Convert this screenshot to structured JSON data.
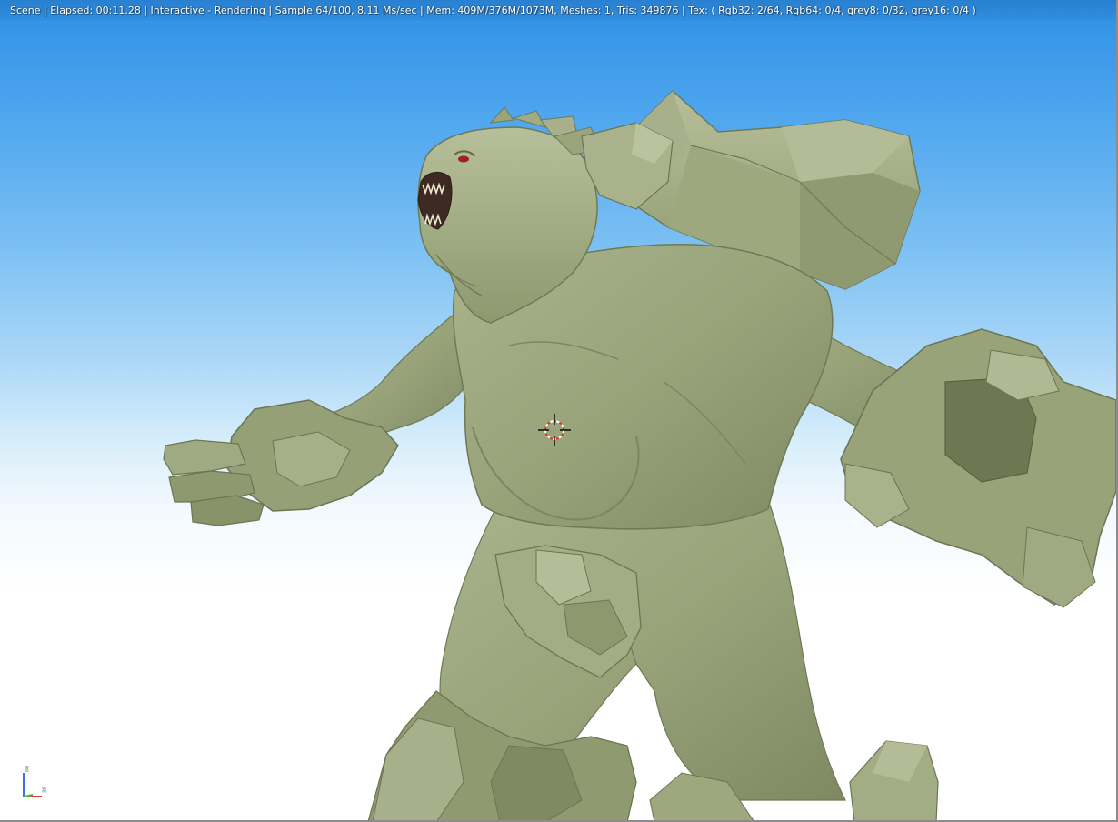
{
  "status_bar": {
    "text": "Scene | Elapsed: 00:11.28 | Interactive - Rendering | Sample 64/100, 8.11 Ms/sec | Mem: 409M/376M/1073M, Meshes: 1, Tris: 349876 | Tex: ( Rgb32: 2/64, Rgb64: 0/4, grey8: 0/32, grey16: 0/4 )"
  },
  "axis_gizmo": {
    "z_label": "z",
    "x_label": "x"
  },
  "colors": {
    "sky_top": "#2f8fe6",
    "sky_horizon": "#ffffff",
    "stone": "#9aa57c",
    "stone_shadow": "#6f7a58",
    "axis_z": "#3a6df0",
    "axis_x": "#e03a2a",
    "axis_y": "#3cc23c"
  },
  "icons": {
    "cursor": "3d-cursor-icon",
    "gizmo": "axis-gizmo-icon"
  }
}
